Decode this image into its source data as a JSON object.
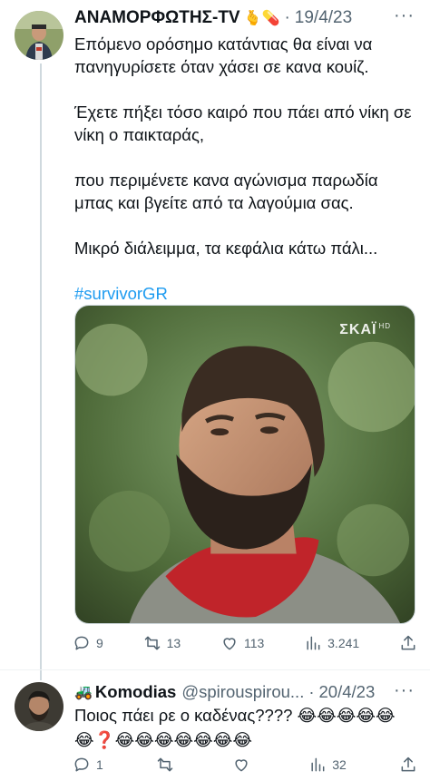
{
  "tweet": {
    "author_name": "ΑΝΑΜΟΡΦΩΤΗΣ-TV",
    "author_emojis": "🫰💊",
    "date": "19/4/23",
    "more": "···",
    "paragraphs": [
      "Επόμενο ορόσημο κατάντιας θα είναι να πανηγυρίσετε όταν χάσει σε κανα κουίζ.",
      "Έχετε πήξει τόσο καιρό που πάει από νίκη σε νίκη ο παικταράς,",
      "που περιμένετε κανα αγώνισμα παρωδία μπας και βγείτε από τα λαγούμια σας.",
      "Μικρό διάλειμμα, τα κεφάλια κάτω πάλι..."
    ],
    "hashtag": "#survivorGR",
    "media_watermark": "ΣΚΑΪ",
    "media_watermark_sub": "HD",
    "stats": {
      "replies": "9",
      "retweets": "13",
      "likes": "113",
      "views": "3.241"
    }
  },
  "reply": {
    "author_emoji": "🚜",
    "author_name": "Komodias",
    "handle": "@spirouspirou...",
    "date": "20/4/23",
    "text": "Ποιος πάει ρε ο καδένας???? 😂😂😂😂😂😂❓😂😂😂😂😂😂😂",
    "stats": {
      "replies": "1",
      "retweets": "",
      "likes": "",
      "views": "32"
    }
  },
  "colors": {
    "accent": "#1d9bf0",
    "text": "#0f1419",
    "secondary": "#536471",
    "border": "#cfd9de"
  }
}
